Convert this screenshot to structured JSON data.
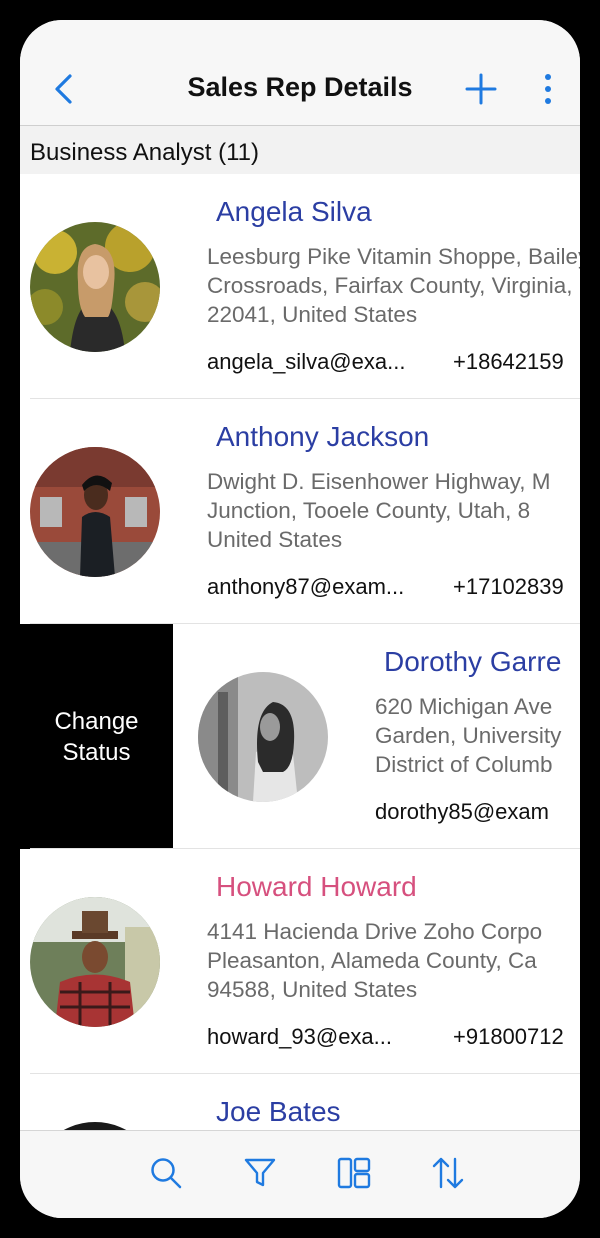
{
  "header": {
    "title": "Sales Rep Details"
  },
  "section": {
    "title": "Business Analyst (11)"
  },
  "swipe_action": {
    "label": "Change Status"
  },
  "records": [
    {
      "name": "Angela Silva",
      "address": "Leesburg Pike Vitamin Shoppe, Bailey's\nCrossroads, Fairfax County, Virginia,\n22041, United States",
      "email": "angela_silva@exa...",
      "phone": "+18642159",
      "name_color": "#2b3ea3"
    },
    {
      "name": "Anthony Jackson",
      "address": "Dwight D. Eisenhower Highway, M\nJunction, Tooele County, Utah, 8\nUnited States",
      "email": "anthony87@exam...",
      "phone": "+17102839",
      "name_color": "#2b3ea3"
    },
    {
      "name": "Dorothy Garre",
      "address": "620 Michigan Ave\nGarden, University\nDistrict of Columb",
      "email": "dorothy85@exam",
      "phone": "",
      "name_color": "#2b3ea3"
    },
    {
      "name": "Howard Howard",
      "address": "4141 Hacienda Drive Zoho Corpo\nPleasanton, Alameda County, Ca\n94588, United States",
      "email": "howard_93@exa...",
      "phone": "+91800712",
      "name_color": "#d6507e"
    },
    {
      "name": "Joe Bates",
      "address": "",
      "email": "",
      "phone": "",
      "name_color": "#2b3ea3"
    }
  ],
  "toolbar": {
    "icons": [
      "search-icon",
      "filter-icon",
      "layout-icon",
      "sort-icon"
    ]
  },
  "colors": {
    "accent": "#1f7ae0",
    "name_default": "#2b3ea3",
    "name_highlight": "#d6507e"
  }
}
